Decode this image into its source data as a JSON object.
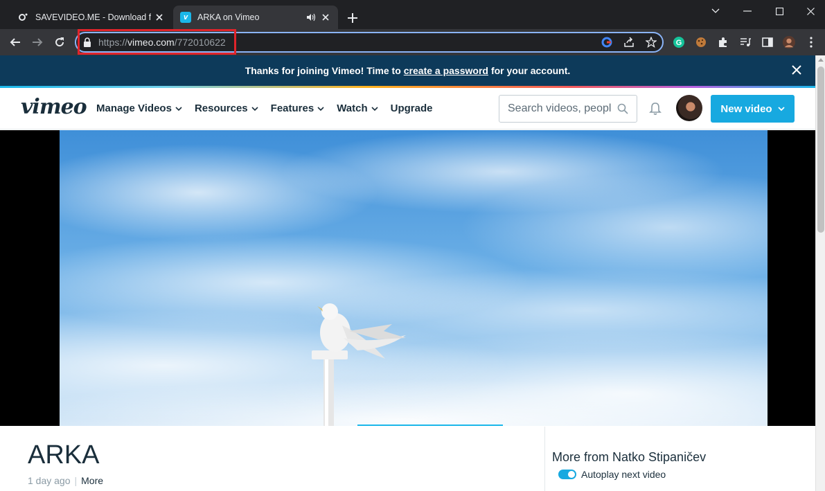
{
  "browser": {
    "tabs": [
      {
        "title": "SAVEVIDEO.ME - Download from",
        "favicon": "savevideo-icon",
        "active": false
      },
      {
        "title": "ARKA on Vimeo",
        "favicon": "vimeo-icon",
        "active": true
      }
    ],
    "omnibox": {
      "url_prefix": "https://",
      "url_domain": "vimeo.com",
      "url_path": "/772010622"
    }
  },
  "banner": {
    "text_before": "Thanks for joining Vimeo! Time to",
    "link": "create a password",
    "text_after": "for your account."
  },
  "nav": {
    "logo": "vimeo",
    "menu": [
      "Manage Videos",
      "Resources",
      "Features",
      "Watch",
      "Upgrade"
    ],
    "search_placeholder": "Search videos, peopl",
    "new_video": "New video"
  },
  "video": {
    "title": "ARKA",
    "uploaded": "1 day ago",
    "more": "More"
  },
  "sidebar": {
    "more_from": "More from Natko Stipaničev",
    "autoplay_label": "Autoplay next video",
    "autoplay_on": true
  },
  "colors": {
    "accent": "#17a9e0",
    "banner": "#0d3a5a",
    "highlight": "#e0242b"
  }
}
